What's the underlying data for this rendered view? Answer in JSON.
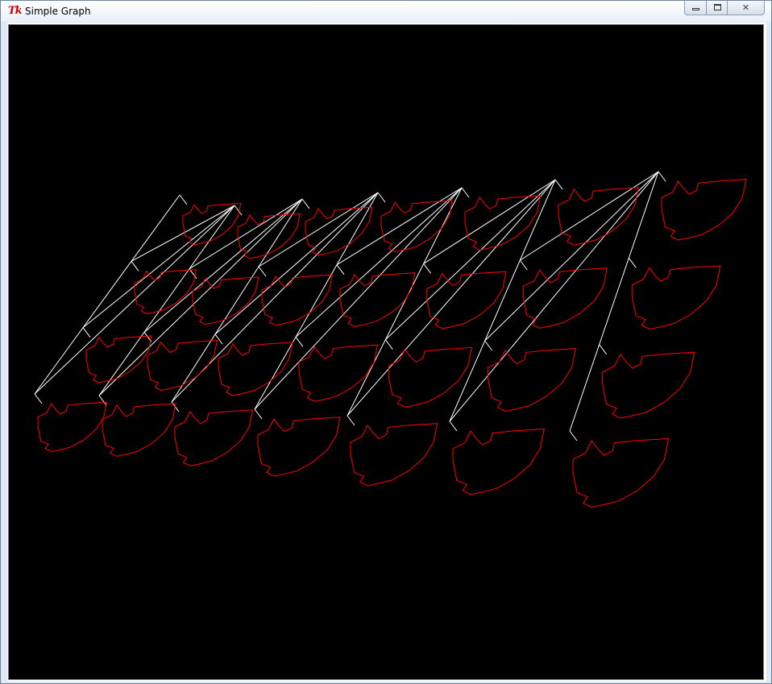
{
  "window": {
    "title": "Simple Graph",
    "app_icon": "tk-feather-icon",
    "app_icon_text": "Tk",
    "buttons": {
      "minimize": "minimize-icon",
      "maximize": "maximize-icon",
      "close": "close-icon",
      "close_glyph": "✕"
    }
  },
  "canvas": {
    "background": "#000000",
    "tree_color": "#ffffff",
    "shape_color": "#ff0000",
    "columns": 7,
    "rows": 4
  }
}
